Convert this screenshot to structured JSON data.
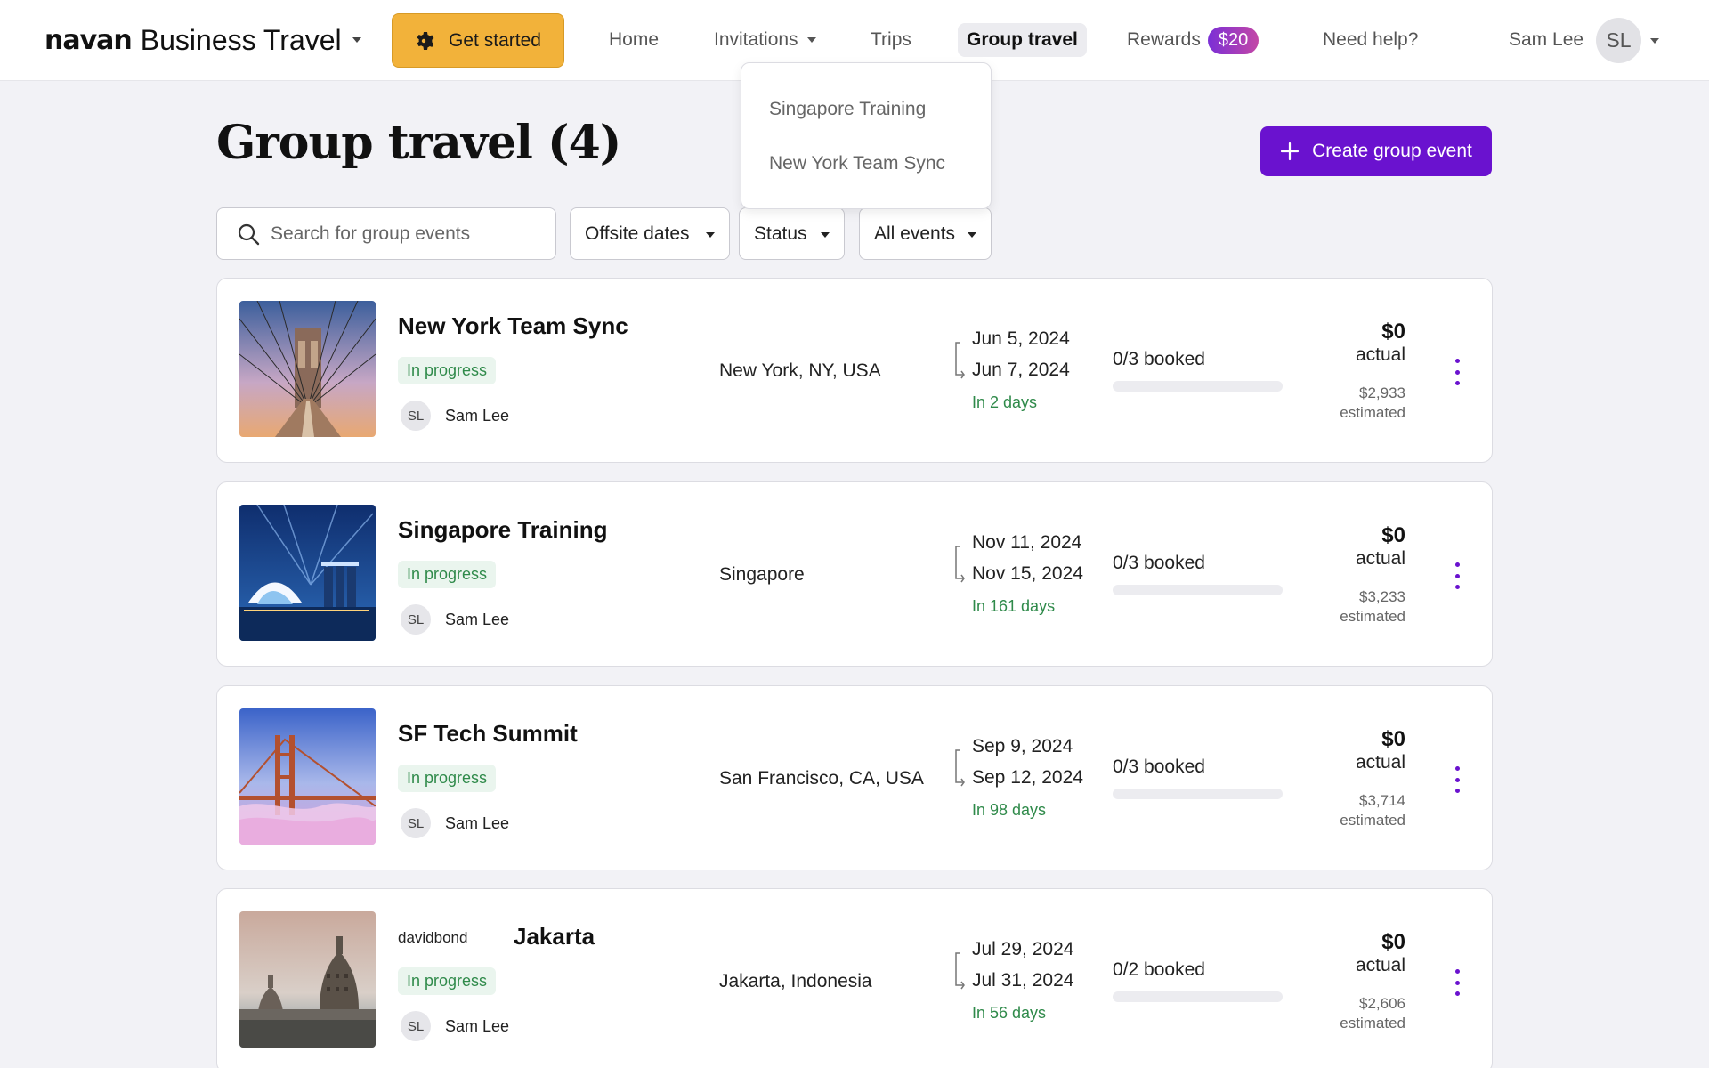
{
  "brand": {
    "logo": "navan",
    "product": "Business Travel"
  },
  "nav": {
    "get_started": "Get started",
    "home": "Home",
    "invitations": "Invitations",
    "trips": "Trips",
    "group_travel": "Group travel",
    "rewards": "Rewards",
    "rewards_badge": "$20",
    "help": "Need help?"
  },
  "user": {
    "name": "Sam Lee",
    "initials": "SL"
  },
  "invitations_dropdown": {
    "items": [
      "Singapore Training",
      "New York Team Sync"
    ]
  },
  "page": {
    "title": "Group travel (4)",
    "create_button": "Create group event"
  },
  "filters": {
    "search_placeholder": "Search for group events",
    "offsite_dates": "Offsite dates",
    "status": "Status",
    "all_events": "All events"
  },
  "events": [
    {
      "title": "New York Team Sync",
      "owner_tag": "",
      "status": "In progress",
      "organizer_initials": "SL",
      "organizer": "Sam Lee",
      "location": "New York, NY, USA",
      "start": "Jun 5, 2024",
      "end": "Jun 7, 2024",
      "until": "In 2 days",
      "booked": "0/3 booked",
      "booked_fraction": 0,
      "actual": "$0",
      "actual_label": "actual",
      "estimated": "$2,933",
      "estimated_label": "estimated"
    },
    {
      "title": "Singapore Training",
      "owner_tag": "",
      "status": "In progress",
      "organizer_initials": "SL",
      "organizer": "Sam Lee",
      "location": "Singapore",
      "start": "Nov 11, 2024",
      "end": "Nov 15, 2024",
      "until": "In 161 days",
      "booked": "0/3 booked",
      "booked_fraction": 0,
      "actual": "$0",
      "actual_label": "actual",
      "estimated": "$3,233",
      "estimated_label": "estimated"
    },
    {
      "title": "SF Tech Summit",
      "owner_tag": "",
      "status": "In progress",
      "organizer_initials": "SL",
      "organizer": "Sam Lee",
      "location": "San Francisco, CA, USA",
      "start": "Sep 9, 2024",
      "end": "Sep 12, 2024",
      "until": "In 98 days",
      "booked": "0/3 booked",
      "booked_fraction": 0,
      "actual": "$0",
      "actual_label": "actual",
      "estimated": "$3,714",
      "estimated_label": "estimated"
    },
    {
      "title": "Jakarta",
      "owner_tag": "davidbond",
      "status": "In progress",
      "organizer_initials": "SL",
      "organizer": "Sam Lee",
      "location": "Jakarta, Indonesia",
      "start": "Jul 29, 2024",
      "end": "Jul 31, 2024",
      "until": "In 56 days",
      "booked": "0/2 booked",
      "booked_fraction": 0,
      "actual": "$0",
      "actual_label": "actual",
      "estimated": "$2,606",
      "estimated_label": "estimated"
    }
  ],
  "colors": {
    "accent": "#6a12cf",
    "cta_yellow": "#f2b23a",
    "status_green": "#2f8a4a",
    "status_bg": "#eaf5ee"
  },
  "icons": {
    "get_started": "gear-icon",
    "create": "plus-icon",
    "search": "search-icon",
    "card_menu": "kebab-menu-icon"
  }
}
